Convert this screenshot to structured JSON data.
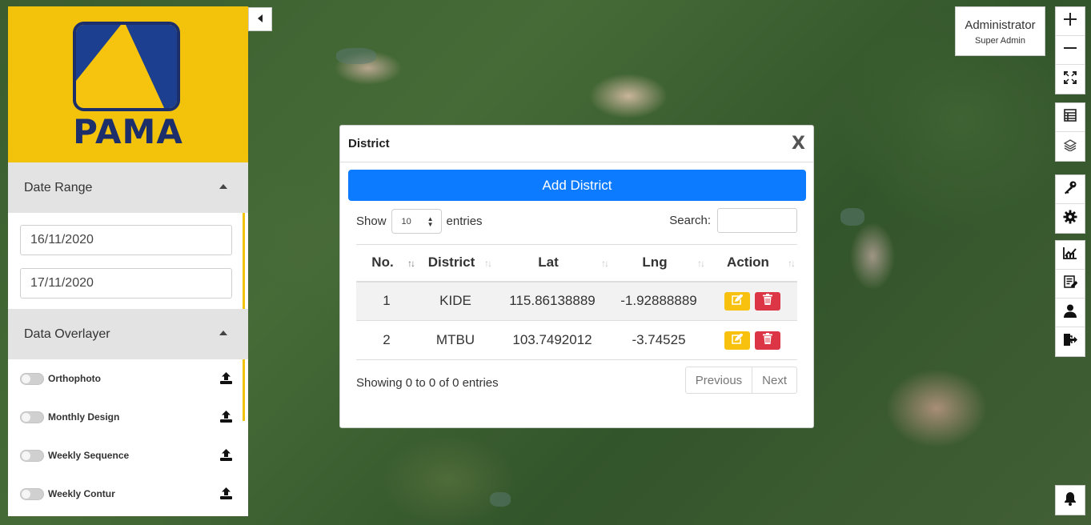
{
  "brand": {
    "logo_text": "PAMA",
    "color_primary": "#f3c30c",
    "color_navy": "#1c2f6b"
  },
  "sidebar": {
    "date_range": {
      "title": "Date Range",
      "start": "16/11/2020",
      "end": "17/11/2020"
    },
    "data_overlayer": {
      "title": "Data Overlayer",
      "items": [
        {
          "label": "Orthophoto",
          "enabled": false
        },
        {
          "label": "Monthly Design",
          "enabled": false
        },
        {
          "label": "Weekly Sequence",
          "enabled": false
        },
        {
          "label": "Weekly Contur",
          "enabled": false
        }
      ]
    }
  },
  "user": {
    "name": "Administrator",
    "role": "Super Admin"
  },
  "toolbar": {
    "groups": [
      [
        "plus-icon",
        "minus-icon",
        "fullscreen-icon"
      ],
      [
        "table-icon",
        "layers-icon"
      ],
      [
        "key-icon",
        "gear-icon"
      ],
      [
        "chart-icon",
        "report-icon",
        "user-icon",
        "logout-icon"
      ]
    ]
  },
  "modal": {
    "title": "District",
    "close": "X",
    "add_button": "Add District",
    "show_label": "Show",
    "entries_label": "entries",
    "page_length": "10",
    "search_label": "Search:",
    "columns": [
      "No.",
      "District",
      "Lat",
      "Lng",
      "Action"
    ],
    "rows": [
      {
        "no": "1",
        "district": "KIDE",
        "lat": "115.86138889",
        "lng": "-1.92888889"
      },
      {
        "no": "2",
        "district": "MTBU",
        "lat": "103.7492012",
        "lng": "-3.74525"
      }
    ],
    "info": "Showing 0 to 0 of 0 entries",
    "prev": "Previous",
    "next": "Next"
  },
  "colors": {
    "add_button": "#0d7bff",
    "edit": "#f7c10d",
    "delete": "#dc3545"
  }
}
